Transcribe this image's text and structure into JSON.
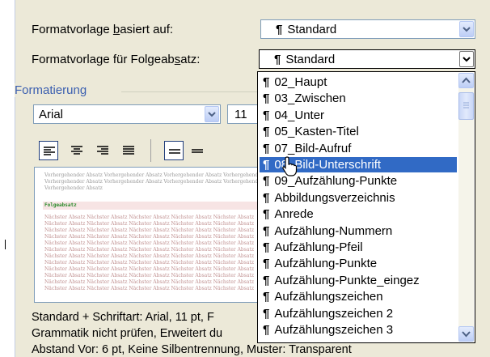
{
  "form": {
    "based_on_label_pre": "Formatvorlage ",
    "based_on_label_key": "b",
    "based_on_label_post": "asiert auf:",
    "based_on_value": "Standard",
    "next_label_pre": "Formatvorlage für Folgeab",
    "next_label_key": "s",
    "next_label_post": "atz:",
    "next_value": "Standard",
    "pilcrow": "¶"
  },
  "formatting": {
    "group_title": "Formatierung",
    "font": "Arial",
    "size": "11"
  },
  "preview": {
    "previous_text": "Vorhergehender Absatz Vorhergehender Absatz Vorhergehender Absatz Vorhergehender Absatz",
    "previous_short": "Vorhergehender Absatz",
    "follow_text": "Folgeabsatz",
    "next_text": "Nächster Absatz Nächster Absatz Nächster Absatz Nächster Absatz Nächster Absatz"
  },
  "description": {
    "line1": "Standard + Schriftart: Arial, 11 pt, F",
    "line2": "Grammatik nicht prüfen, Erweitert du",
    "line3": "Abstand Vor:  6 pt, Keine Silbentrennung, Muster: Transparent"
  },
  "style_list": {
    "selected_index": 5,
    "items": [
      "02_Haupt",
      "03_Zwischen",
      "04_Unter",
      "05_Kasten-Titel",
      "07_Bild-Aufruf",
      "08_Bild-Unterschrift",
      "09_Aufzählung-Punkte",
      "Abbildungsverzeichnis",
      "Anrede",
      "Aufzählung-Nummern",
      "Aufzählung-Pfeil",
      "Aufzählung-Punkte",
      "Aufzählung-Punkte_eingez",
      "Aufzählungszeichen",
      "Aufzählungszeichen 2",
      "Aufzählungszeichen 3"
    ]
  },
  "colors": {
    "dialog_bg": "#ece9d8",
    "selection": "#316ac5",
    "group_title": "#3b5fb0"
  }
}
